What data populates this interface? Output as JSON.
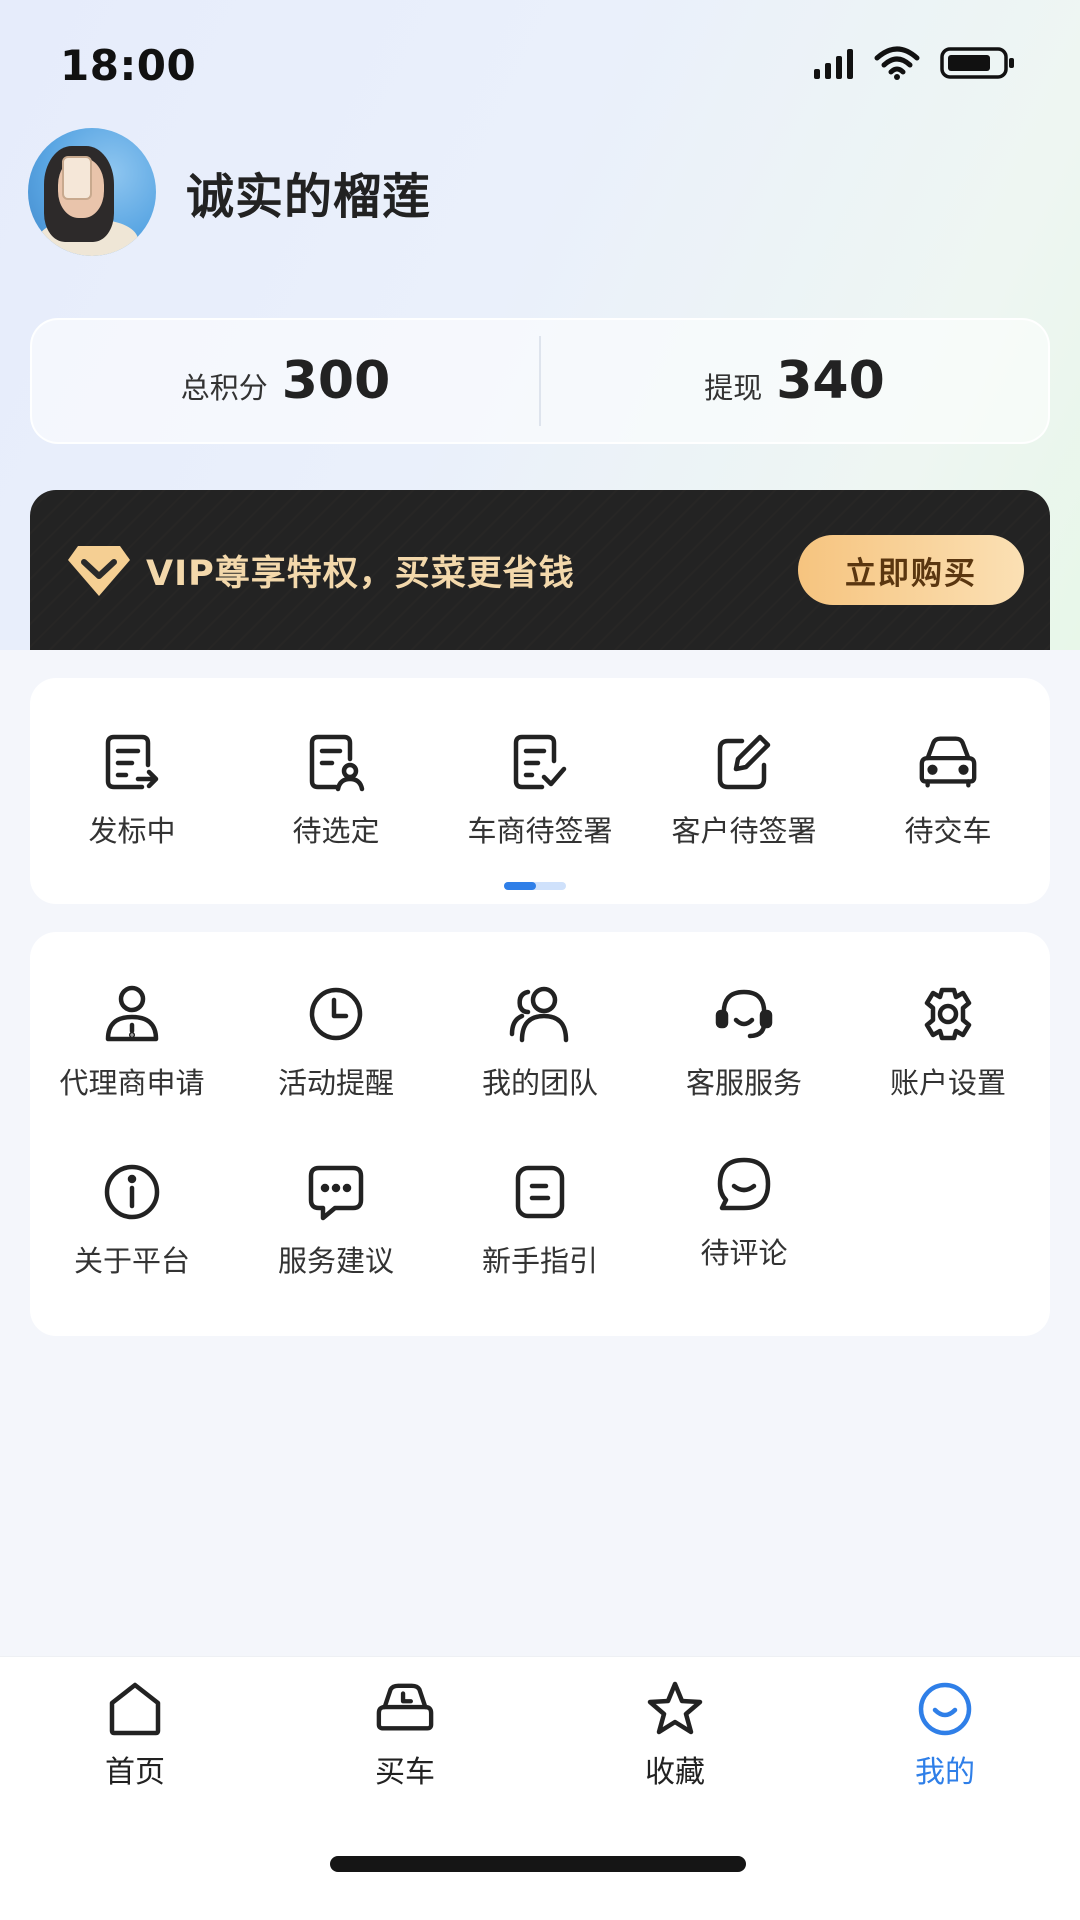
{
  "status_bar": {
    "time": "18:00",
    "icons": [
      "signal-icon",
      "wifi-icon",
      "battery-icon"
    ]
  },
  "profile": {
    "name": "诚实的榴莲",
    "avatar": "avatar-photo"
  },
  "stats": {
    "points_label": "总积分",
    "points_value": "300",
    "withdraw_label": "提现",
    "withdraw_value": "340"
  },
  "vip": {
    "text": "VIP尊享特权，买菜更省钱",
    "button": "立即购买",
    "icon": "diamond-icon",
    "accent": "#F3D8AB"
  },
  "orders": {
    "items": [
      {
        "label": "发标中",
        "icon": "document-arrow-icon"
      },
      {
        "label": "待选定",
        "icon": "document-user-icon"
      },
      {
        "label": "车商待签署",
        "icon": "document-check-icon"
      },
      {
        "label": "客户待签署",
        "icon": "edit-square-icon"
      },
      {
        "label": "待交车",
        "icon": "car-icon"
      }
    ],
    "page_index": 1,
    "page_count": 2
  },
  "tools": {
    "items": [
      {
        "label": "代理商申请",
        "icon": "agent-user-icon"
      },
      {
        "label": "活动提醒",
        "icon": "clock-icon"
      },
      {
        "label": "我的团队",
        "icon": "team-icon"
      },
      {
        "label": "客服服务",
        "icon": "headset-icon"
      },
      {
        "label": "账户设置",
        "icon": "gear-icon"
      },
      {
        "label": "关于平台",
        "icon": "info-icon"
      },
      {
        "label": "服务建议",
        "icon": "chat-dots-icon"
      },
      {
        "label": "新手指引",
        "icon": "guide-icon"
      },
      {
        "label": "待评论",
        "icon": "comment-smile-icon"
      }
    ]
  },
  "tab_bar": {
    "items": [
      {
        "label": "首页",
        "icon": "home-icon"
      },
      {
        "label": "买车",
        "icon": "car-clock-icon"
      },
      {
        "label": "收藏",
        "icon": "star-icon"
      },
      {
        "label": "我的",
        "icon": "smile-icon",
        "active": true
      }
    ],
    "active_color": "#2F7FE8"
  }
}
